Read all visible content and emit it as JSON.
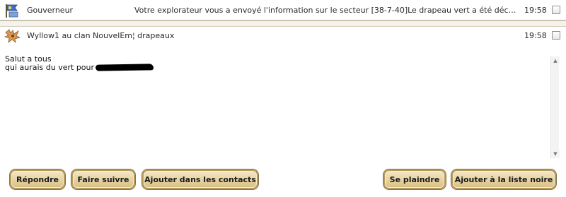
{
  "messages": [
    {
      "sender": "Gouverneur",
      "subject": "Votre explorateur vous a envoyé l'information sur le secteur [38-7-40]Le drapeau vert a été découvert",
      "time": "19:58",
      "icon": "governor-flag-icon"
    },
    {
      "sender": "Wyllow1 au clan NouvelEm¦ drapeaux",
      "time": "19:58",
      "icon": "dragon-avatar-icon"
    }
  ],
  "body": {
    "line1": "Salut a tous",
    "line2": "qui aurais du vert pour"
  },
  "actions": {
    "reply": "Répondre",
    "forward": "Faire suivre",
    "add_contacts": "Ajouter dans les contacts",
    "complain": "Se plaindre",
    "blacklist": "Ajouter à la liste noire"
  },
  "colors": {
    "button_fill": "#e6d2a0",
    "button_border": "#b89c5e",
    "separator": "#c9c2ad"
  }
}
